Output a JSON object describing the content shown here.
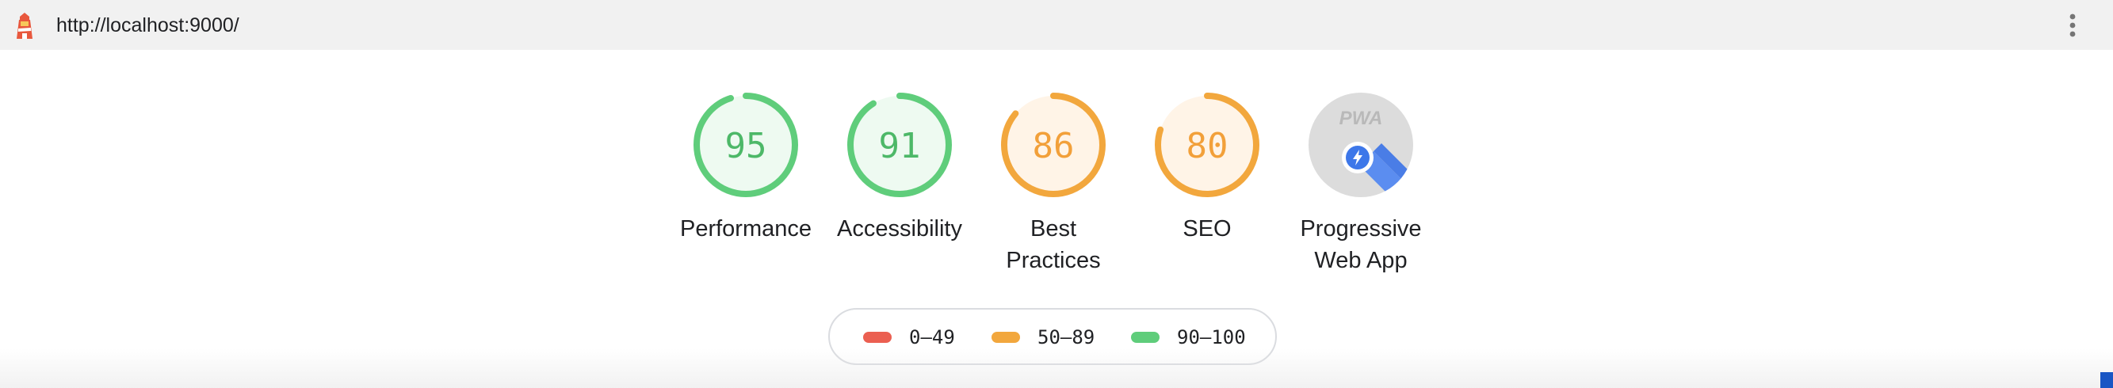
{
  "header": {
    "url": "http://localhost:9000/",
    "logo_icon": "lighthouse-icon",
    "menu_icon": "more-vert-icon"
  },
  "gauges": [
    {
      "id": "performance",
      "score": 95,
      "score_text": "95",
      "label": "Performance",
      "label_lines": [
        "Performance"
      ],
      "status": "pass"
    },
    {
      "id": "accessibility",
      "score": 91,
      "score_text": "91",
      "label": "Accessibility",
      "label_lines": [
        "Accessibility"
      ],
      "status": "pass"
    },
    {
      "id": "best-practices",
      "score": 86,
      "score_text": "86",
      "label": "Best Practices",
      "label_lines": [
        "Best",
        "Practices"
      ],
      "status": "average"
    },
    {
      "id": "seo",
      "score": 80,
      "score_text": "80",
      "label": "SEO",
      "label_lines": [
        "SEO"
      ],
      "status": "average"
    },
    {
      "id": "pwa",
      "score": null,
      "score_text": "",
      "label": "Progressive Web App",
      "label_lines": [
        "Progressive",
        "Web App"
      ],
      "status": "pwa",
      "badge_text": "PWA",
      "badge_icon": "pwa-installable-icon"
    }
  ],
  "legend": [
    {
      "range": "0–49",
      "color": "#eb5f51"
    },
    {
      "range": "50–89",
      "color": "#f2a73d"
    },
    {
      "range": "90–100",
      "color": "#5fcd7b"
    }
  ],
  "colors": {
    "pass": "#5fcd7b",
    "pass_fill": "#eefaf1",
    "pass_text": "#4db868",
    "average": "#f2a73d",
    "average_fill": "#fff4e7",
    "average_text": "#f2a03a",
    "fail": "#eb5f51",
    "pwa_bg": "#dcdcdc",
    "pwa_badge_blue": "#3d77e9"
  }
}
